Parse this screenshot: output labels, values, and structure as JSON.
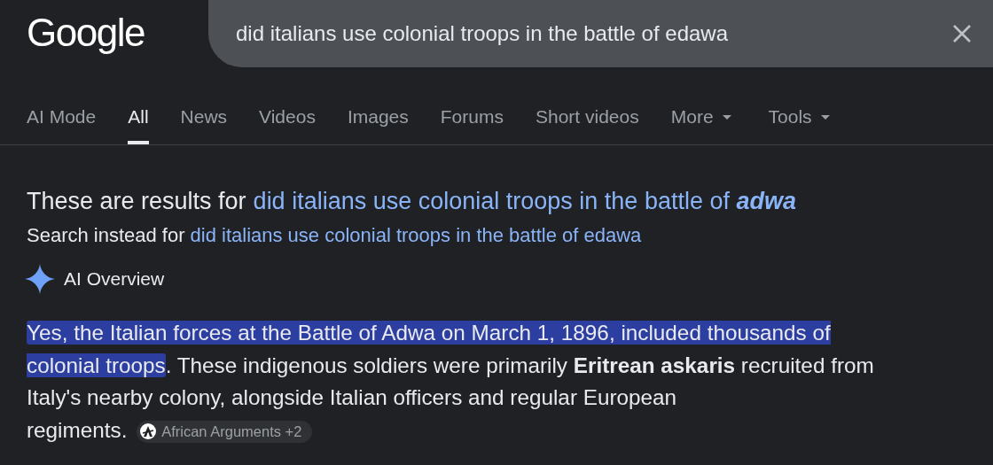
{
  "logo": "Google",
  "search": {
    "value": "did italians use colonial troops in the battle of edawa"
  },
  "tabs": [
    {
      "label": "AI Mode",
      "selected": false,
      "kind": "tab"
    },
    {
      "label": "All",
      "selected": true,
      "kind": "tab"
    },
    {
      "label": "News",
      "selected": false,
      "kind": "tab"
    },
    {
      "label": "Videos",
      "selected": false,
      "kind": "tab"
    },
    {
      "label": "Images",
      "selected": false,
      "kind": "tab"
    },
    {
      "label": "Forums",
      "selected": false,
      "kind": "tab"
    },
    {
      "label": "Short videos",
      "selected": false,
      "kind": "tab"
    },
    {
      "label": "More",
      "selected": false,
      "kind": "menu"
    },
    {
      "label": "Tools",
      "selected": false,
      "kind": "menu"
    }
  ],
  "correction": {
    "prefix": "These are results for",
    "link": "did italians use colonial troops in the battle of **adwa**"
  },
  "instead": {
    "prefix": "Search instead for",
    "link": "did italians use colonial troops in the battle of edawa"
  },
  "ai_overview": {
    "label": "AI Overview",
    "highlight": "Yes, the Italian forces at the Battle of Adwa on March 1, 1896, included thousands of colonial troops",
    "body": ". These indigenous soldiers were primarily **Eritrean askaris** recruited from Italy's nearby colony, alongside Italian officers and regular European",
    "tail": "regiments.",
    "source": "African Arguments +2"
  }
}
